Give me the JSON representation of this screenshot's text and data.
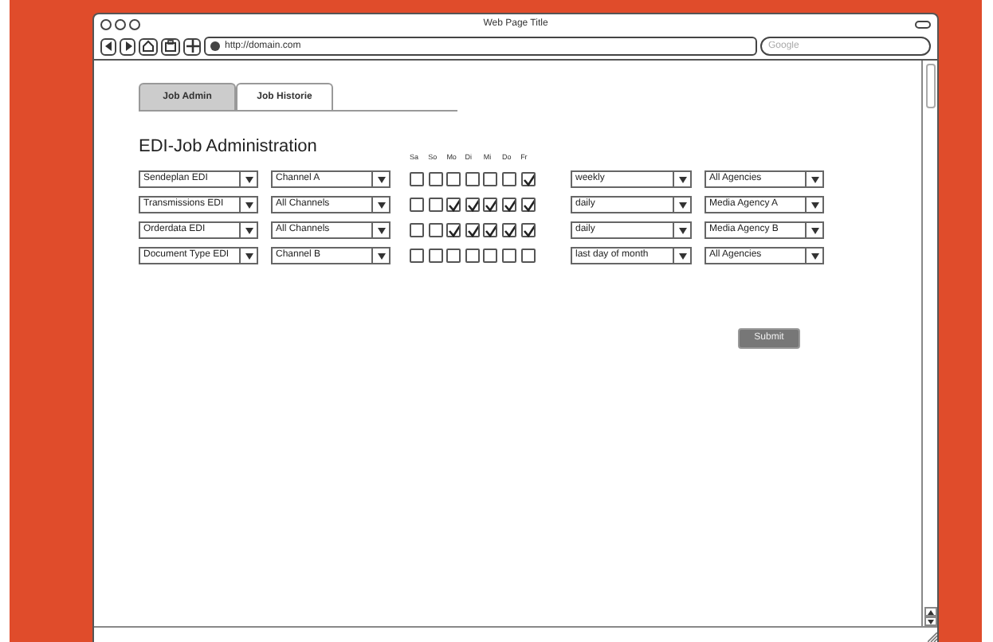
{
  "window": {
    "title": "Web Page Title",
    "url": "http://domain.com",
    "search_placeholder": "Google"
  },
  "tabs": [
    {
      "label": "Job Admin",
      "selected": false
    },
    {
      "label": "Job Historie",
      "selected": true
    }
  ],
  "heading": "EDI-Job Administration",
  "days": [
    "Sa",
    "So",
    "Mo",
    "Di",
    "Mi",
    "Do",
    "Fr"
  ],
  "rows": [
    {
      "job": "Sendeplan EDI",
      "channel": "Channel A",
      "days": [
        false,
        false,
        false,
        false,
        false,
        false,
        true
      ],
      "frequency": "weekly",
      "agency": "All Agencies"
    },
    {
      "job": "Transmissions EDI",
      "channel": "All Channels",
      "days": [
        false,
        false,
        true,
        true,
        true,
        true,
        true
      ],
      "frequency": "daily",
      "agency": "Media Agency A"
    },
    {
      "job": "Orderdata EDI",
      "channel": "All Channels",
      "days": [
        false,
        false,
        true,
        true,
        true,
        true,
        true
      ],
      "frequency": "daily",
      "agency": "Media Agency B"
    },
    {
      "job": "Document Type EDI",
      "channel": "Channel B",
      "days": [
        false,
        false,
        false,
        false,
        false,
        false,
        false
      ],
      "frequency": "last day of month",
      "agency": "All Agencies"
    }
  ],
  "submit": "Submit"
}
